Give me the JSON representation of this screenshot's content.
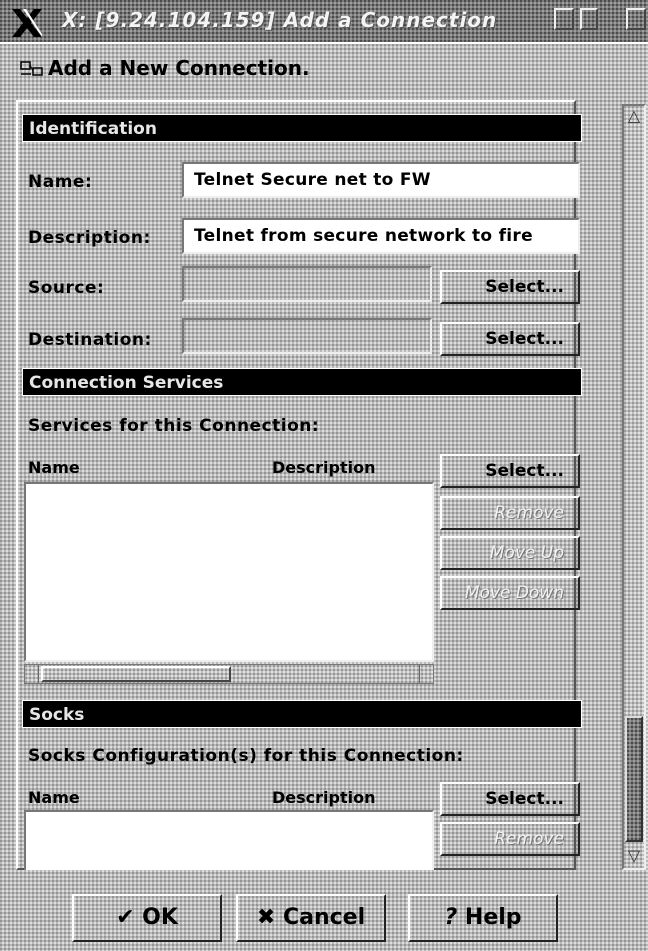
{
  "window": {
    "title": "X: [9.24.104.159] Add a Connection",
    "icons": {
      "logo": "x-logo-icon",
      "maximize": "maximize-icon",
      "minimize": "minimize-icon",
      "menu": "window-menu-icon"
    }
  },
  "header": {
    "icon": "network-connection-icon",
    "title": "Add a New Connection."
  },
  "identification": {
    "section_title": "Identification",
    "name_label": "Name:",
    "name_value": "Telnet  Secure net to FW",
    "description_label": "Description:",
    "description_value": "Telnet from secure network to fire",
    "source_label": "Source:",
    "source_value": "",
    "destination_label": "Destination:",
    "destination_value": "",
    "select_label": "Select..."
  },
  "connection_services": {
    "section_title": "Connection Services",
    "subtitle": "Services for this Connection:",
    "columns": [
      "Name",
      "Description"
    ],
    "rows": [],
    "buttons": {
      "select": "Select...",
      "remove": "Remove",
      "move_up": "Move Up",
      "move_down": "Move Down"
    }
  },
  "socks": {
    "section_title": "Socks",
    "subtitle": "Socks Configuration(s) for this Connection:",
    "columns": [
      "Name",
      "Description"
    ],
    "rows": [],
    "buttons": {
      "select": "Select...",
      "remove": "Remove"
    }
  },
  "footer": {
    "ok_label": "OK",
    "ok_icon": "checkmark-icon",
    "cancel_label": "Cancel",
    "cancel_icon": "x-cancel-icon",
    "help_label": "Help",
    "help_icon": "question-mark-icon"
  }
}
